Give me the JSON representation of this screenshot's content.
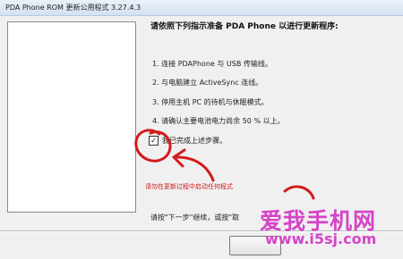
{
  "window": {
    "title": "PDA Phone ROM 更新公用程式 3.27.4.3"
  },
  "content": {
    "heading": "请依照下列指示准备 PDA Phone 以进行更新程序:",
    "steps": [
      "1. 连接 PDAPhone 与 USB 传输线。",
      "2. 与电脑建立 ActiveSync 连线。",
      "3. 停用主机 PC 的待机与休眠模式。",
      "4. 请确认主要电池电力尚余 50 % 以上。"
    ],
    "checkbox": {
      "label": "我已完成上述步骤。",
      "checked": true,
      "mark": "✓"
    },
    "warning": "请勿在更新过程中启动任何程式",
    "instruction": "请按\"下一步\"继续，或按\"取"
  },
  "watermark": {
    "text": "爱我手机网",
    "url": "www.i5sj.com",
    "color": "#d444c8"
  },
  "colors": {
    "annotation_red": "#d21a1a",
    "warning_red": "#d21a1a"
  }
}
